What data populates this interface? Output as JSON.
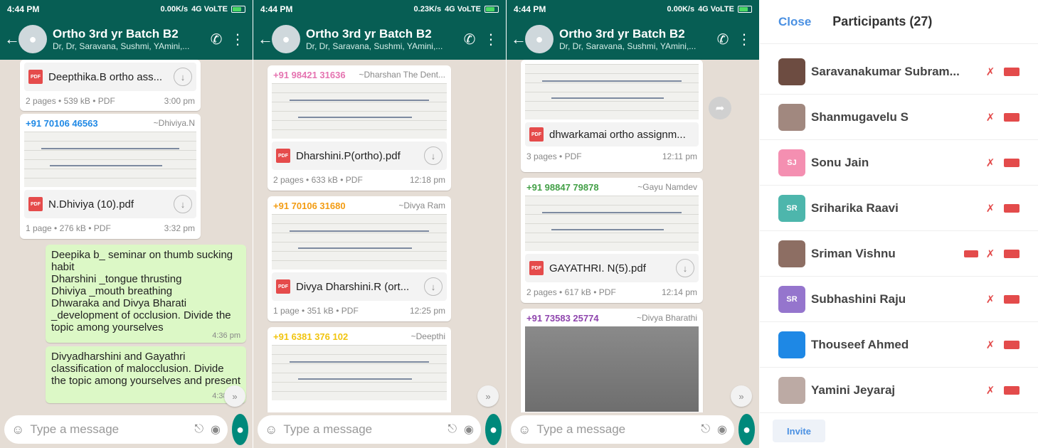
{
  "status": {
    "time": "4:44 PM",
    "speeds": [
      "0.00K/s",
      "0.23K/s",
      "0.00K/s"
    ],
    "network": "4G VoLTE"
  },
  "chat": {
    "title": "Ortho 3rd yr Batch B2",
    "subtitle": "Dr, Dr, Saravana, Sushmi, YAmini,...",
    "input_placeholder": "Type a message"
  },
  "icons": {
    "back": "back-arrow-icon",
    "add_call": "add-call-icon",
    "menu": "more-vert-icon",
    "emoji": "emoji-icon",
    "attach": "paperclip-icon",
    "camera": "camera-icon",
    "mic": "mic-icon",
    "download": "download-icon",
    "scroll": "double-chevron-down-icon",
    "forward": "forward-icon"
  },
  "phone1": {
    "doc1": {
      "name": "Deepthika.B ortho ass...",
      "meta": "2 pages • 539 kB • PDF",
      "time": "3:00 pm"
    },
    "doc2": {
      "sender": "+91 70106 46563",
      "sender_name": "~Dhiviya.N",
      "name": "N.Dhiviya (10).pdf",
      "meta": "1 page • 276 kB • PDF",
      "time": "3:32 pm"
    },
    "msg1": {
      "text": "Deepika b_  seminar on thumb sucking habit\nDharshini _tongue thrusting\nDhiviya _mouth breathing\nDhwaraka and Divya Bharati _development of occlusion. Divide the topic among yourselves",
      "time": "4:36 pm"
    },
    "msg2": {
      "text": "Divyadharshini and Gayathri classification of malocclusion. Divide the topic among yourselves and present",
      "time": "4:38 pm"
    }
  },
  "phone2": {
    "doc1": {
      "sender": "+91 98421 31636",
      "sender_name": "~Dharshan The Dent...",
      "name": "Dharshini.P(ortho).pdf",
      "meta": "2 pages • 633 kB • PDF",
      "time": "12:18 pm"
    },
    "doc2": {
      "sender": "+91 70106 31680",
      "sender_name": "~Divya Ram",
      "name": "Divya Dharshini.R (ort...",
      "meta": "1 page • 351 kB • PDF",
      "time": "12:25 pm"
    },
    "doc3": {
      "sender": "+91 6381 376 102",
      "sender_name": "~Deepthi"
    }
  },
  "phone3": {
    "doc1": {
      "name": "dhwarkamai ortho assignm...",
      "meta": "3 pages • PDF",
      "time": "12:11 pm"
    },
    "doc2": {
      "sender": "+91 98847 79878",
      "sender_name": "~Gayu Namdev",
      "name": "GAYATHRI. N(5).pdf",
      "meta": "2 pages • 617 kB • PDF",
      "time": "12:14 pm"
    },
    "doc3": {
      "sender": "+91 73583 25774",
      "sender_name": "~Divya Bharathi"
    }
  },
  "participants": {
    "close_label": "Close",
    "title": "Participants (27)",
    "invite_label": "Invite",
    "list": [
      {
        "name": "Saravanakumar Subram...",
        "initials": "",
        "color": "#6d4c41"
      },
      {
        "name": "Shanmugavelu S",
        "initials": "",
        "color": "#a1887f"
      },
      {
        "name": "Sonu Jain",
        "initials": "SJ",
        "color": "#f48fb1"
      },
      {
        "name": "Sriharika Raavi",
        "initials": "SR",
        "color": "#4db6ac"
      },
      {
        "name": "Sriman Vishnu",
        "initials": "",
        "color": "#8d6e63"
      },
      {
        "name": "Subhashini Raju",
        "initials": "SR",
        "color": "#9575cd"
      },
      {
        "name": "Thouseef Ahmed",
        "initials": "",
        "color": "#1e88e5"
      },
      {
        "name": "Yamini Jeyaraj",
        "initials": "",
        "color": "#bcaaa4"
      }
    ]
  }
}
